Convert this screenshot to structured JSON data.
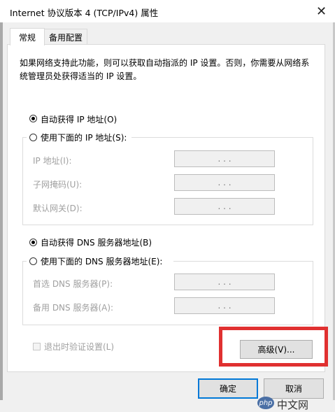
{
  "window": {
    "title": "Internet 协议版本 4 (TCP/IPv4) 属性",
    "close_glyph": "✕"
  },
  "tabs": [
    {
      "label": "常规"
    },
    {
      "label": "备用配置"
    }
  ],
  "description": "如果网络支持此功能，则可以获取自动指派的 IP 设置。否则，你需要从网络系统管理员处获得适当的 IP 设置。",
  "ip": {
    "auto_label": "自动获得 IP 地址(O)",
    "auto_selected": true,
    "manual_label": "使用下面的 IP 地址(S):",
    "fields": [
      {
        "label": "IP 地址(I):",
        "value": ".   .   ."
      },
      {
        "label": "子网掩码(U):",
        "value": ".   .   ."
      },
      {
        "label": "默认网关(D):",
        "value": ".   .   ."
      }
    ]
  },
  "dns": {
    "auto_label": "自动获得 DNS 服务器地址(B)",
    "auto_selected": true,
    "manual_label": "使用下面的 DNS 服务器地址(E):",
    "fields": [
      {
        "label": "首选 DNS 服务器(P):",
        "value": ".   .   ."
      },
      {
        "label": "备用 DNS 服务器(A):",
        "value": ".   .   ."
      }
    ]
  },
  "validate_on_exit": {
    "label": "退出时验证设置(L)",
    "checked": false
  },
  "buttons": {
    "advanced": "高级(V)...",
    "ok": "确定",
    "cancel": "取消"
  },
  "watermark": {
    "logo_text": "php",
    "text": "中文网"
  },
  "colors": {
    "highlight": "#e03030",
    "default_button_border": "#0078d7"
  }
}
